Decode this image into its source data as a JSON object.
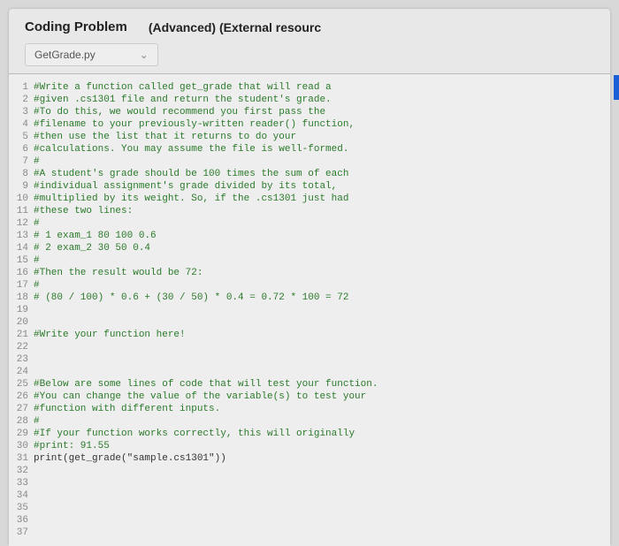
{
  "header": {
    "title": "Coding Problem",
    "subtitle": "(Advanced) (External resourc"
  },
  "file_tab": {
    "name": "GetGrade.py"
  },
  "code_lines": [
    {
      "n": 1,
      "t": "#Write a function called get_grade that will read a",
      "c": true
    },
    {
      "n": 2,
      "t": "#given .cs1301 file and return the student's grade.",
      "c": true
    },
    {
      "n": 3,
      "t": "#To do this, we would recommend you first pass the",
      "c": true
    },
    {
      "n": 4,
      "t": "#filename to your previously-written reader() function,",
      "c": true
    },
    {
      "n": 5,
      "t": "#then use the list that it returns to do your",
      "c": true
    },
    {
      "n": 6,
      "t": "#calculations. You may assume the file is well-formed.",
      "c": true
    },
    {
      "n": 7,
      "t": "#",
      "c": true
    },
    {
      "n": 8,
      "t": "#A student's grade should be 100 times the sum of each",
      "c": true
    },
    {
      "n": 9,
      "t": "#individual assignment's grade divided by its total,",
      "c": true
    },
    {
      "n": 10,
      "t": "#multiplied by its weight. So, if the .cs1301 just had",
      "c": true
    },
    {
      "n": 11,
      "t": "#these two lines:",
      "c": true
    },
    {
      "n": 12,
      "t": "#",
      "c": true
    },
    {
      "n": 13,
      "t": "# 1 exam_1 80 100 0.6",
      "c": true
    },
    {
      "n": 14,
      "t": "# 2 exam_2 30 50 0.4",
      "c": true
    },
    {
      "n": 15,
      "t": "#",
      "c": true
    },
    {
      "n": 16,
      "t": "#Then the result would be 72:",
      "c": true
    },
    {
      "n": 17,
      "t": "#",
      "c": true
    },
    {
      "n": 18,
      "t": "# (80 / 100) * 0.6 + (30 / 50) * 0.4 = 0.72 * 100 = 72",
      "c": true
    },
    {
      "n": 19,
      "t": "",
      "c": false
    },
    {
      "n": 20,
      "t": "",
      "c": false
    },
    {
      "n": 21,
      "t": "#Write your function here!",
      "c": true
    },
    {
      "n": 22,
      "t": "",
      "c": false
    },
    {
      "n": 23,
      "t": "",
      "c": false
    },
    {
      "n": 24,
      "t": "",
      "c": false
    },
    {
      "n": 25,
      "t": "#Below are some lines of code that will test your function.",
      "c": true
    },
    {
      "n": 26,
      "t": "#You can change the value of the variable(s) to test your",
      "c": true
    },
    {
      "n": 27,
      "t": "#function with different inputs.",
      "c": true
    },
    {
      "n": 28,
      "t": "#",
      "c": true
    },
    {
      "n": 29,
      "t": "#If your function works correctly, this will originally",
      "c": true
    },
    {
      "n": 30,
      "t": "#print: 91.55",
      "c": true
    },
    {
      "n": 31,
      "t": "print(get_grade(\"sample.cs1301\"))",
      "c": false
    },
    {
      "n": 32,
      "t": "",
      "c": false
    },
    {
      "n": 33,
      "t": "",
      "c": false
    },
    {
      "n": 34,
      "t": "",
      "c": false
    },
    {
      "n": 35,
      "t": "",
      "c": false
    },
    {
      "n": 36,
      "t": "",
      "c": false
    },
    {
      "n": 37,
      "t": "",
      "c": false
    }
  ]
}
